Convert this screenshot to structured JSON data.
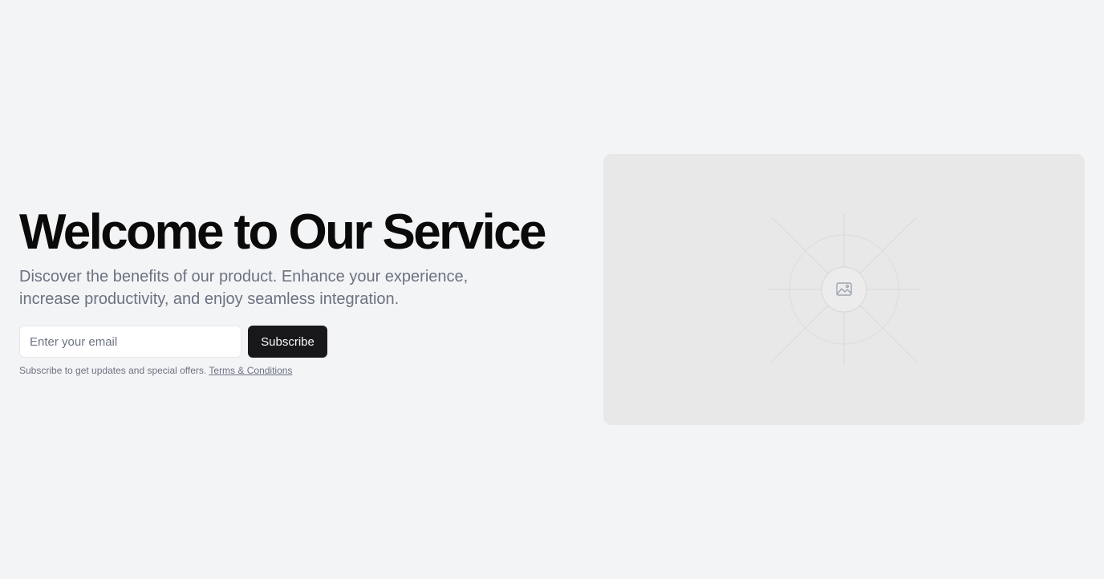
{
  "hero": {
    "title": "Welcome to Our Service",
    "subtitle": "Discover the benefits of our product. Enhance your experience, increase productivity, and enjoy seamless integration.",
    "email_placeholder": "Enter your email",
    "subscribe_label": "Subscribe",
    "fineprint_text": "Subscribe to get updates and special offers.",
    "terms_link": "Terms & Conditions"
  },
  "media": {
    "icon": "image-icon"
  },
  "colors": {
    "background": "#f3f4f6",
    "button": "#18181b",
    "muted_text": "#6b7280",
    "placeholder_bg": "#e8e8e8"
  }
}
